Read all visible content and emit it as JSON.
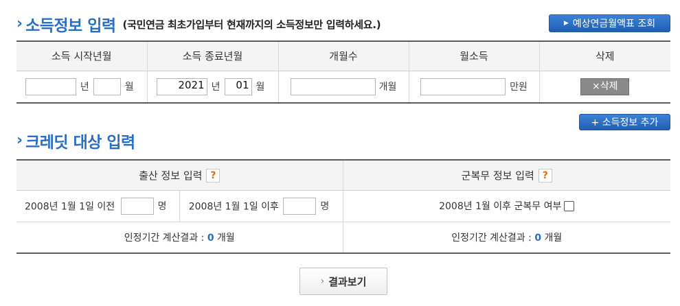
{
  "section1": {
    "chevron": "›",
    "title": "소득정보 입력",
    "subtitle": "(국민연금 최초가입부터 현재까지의 소득정보만 입력하세요.)",
    "lookup_button": "예상연금월액표 조회",
    "lookup_icon": "▶"
  },
  "income_table": {
    "headers": [
      "소득 시작년월",
      "소득 종료년월",
      "개월수",
      "월소득",
      "삭제"
    ],
    "row": {
      "start_year": "",
      "start_month": "",
      "end_year": "2021",
      "end_month": "01",
      "months": "",
      "monthly_income": "",
      "unit_year": "년",
      "unit_month": "월",
      "unit_months": "개월",
      "unit_income": "만원",
      "delete_label": "×삭제"
    }
  },
  "add_income_button": "+ 소득정보 추가",
  "section2": {
    "chevron": "›",
    "title": "크레딧 대상 입력"
  },
  "credit_table": {
    "birth_header": "출산 정보 입력",
    "military_header": "군복무 정보 입력",
    "help": "?",
    "before_2008_label": "2008년 1월 1일 이전",
    "after_2008_label": "2008년 1월 1일 이후",
    "persons_unit": "명",
    "before_value": "",
    "after_value": "",
    "military_label": "2008년 1월 이후 군복무 여부",
    "result_label": "인정기간 계산결과 :",
    "birth_result": "0",
    "military_result": "0",
    "result_unit": "개월"
  },
  "result_button": {
    "arrow": "›",
    "label": "결과보기"
  }
}
